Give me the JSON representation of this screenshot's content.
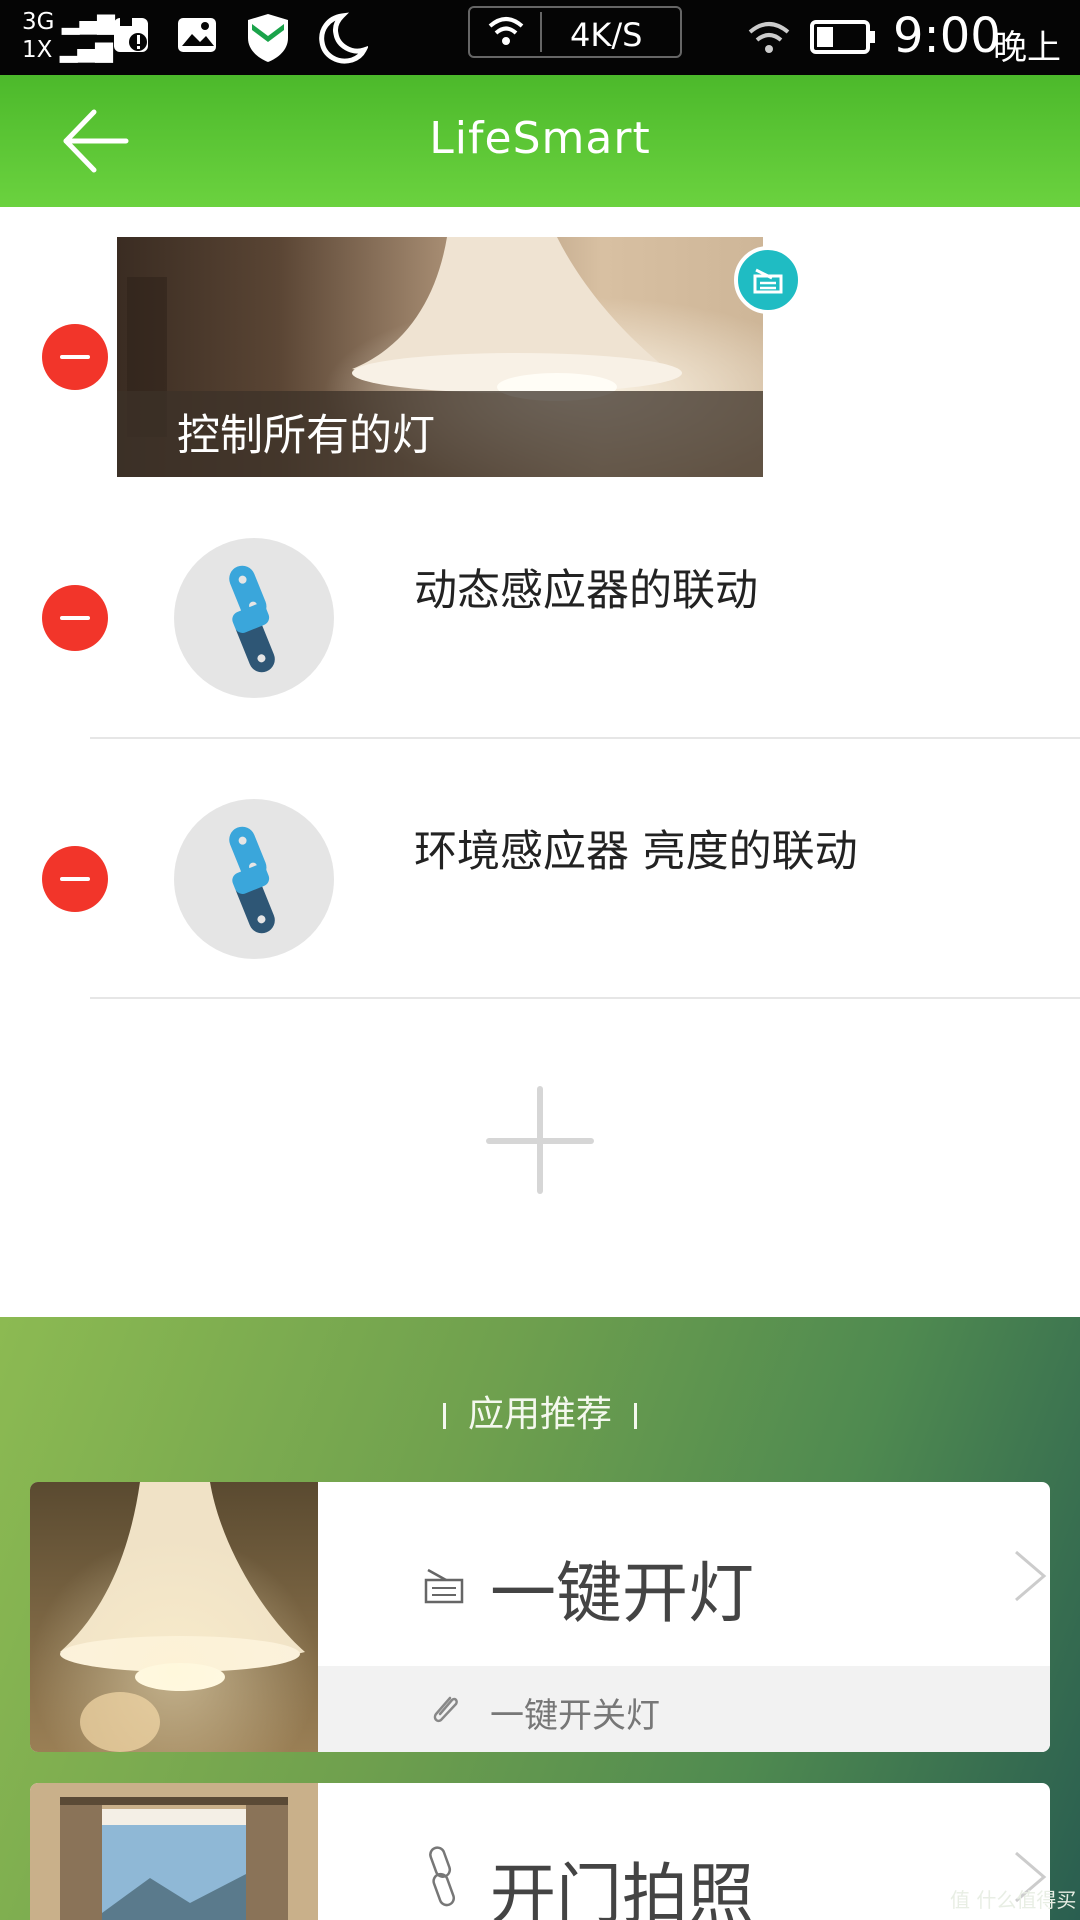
{
  "status_bar": {
    "net_top": "3G",
    "net_bottom": "1X",
    "speed": "4K/S",
    "time": "9:00",
    "period": "晚上",
    "icons": [
      "signal-icon",
      "sim-alert-icon",
      "image-icon",
      "shield-icon",
      "moon-icon",
      "wifi-icon",
      "battery-icon"
    ]
  },
  "app_bar": {
    "title": "LifeSmart",
    "back_icon": "back-arrow-icon"
  },
  "scenes": [
    {
      "type": "image-card",
      "label": "控制所有的灯",
      "badge_icon": "scene-badge-icon"
    },
    {
      "type": "linkage",
      "label": "动态感应器的联动",
      "icon": "chain-link-icon"
    },
    {
      "type": "linkage",
      "label": "环境感应器 亮度的联动",
      "icon": "chain-link-icon"
    }
  ],
  "add_button_icon": "plus-icon",
  "recommend": {
    "title": "应用推荐",
    "items": [
      {
        "name": "一键开灯",
        "subtitle": "一键开关灯",
        "icon": "scene-icon",
        "sub_icon": "paperclip-icon"
      },
      {
        "name": "开门拍照",
        "icon": "chain-link-icon"
      }
    ]
  },
  "watermark": "值 什么值得买",
  "colors": {
    "accent_green": "#5cc536",
    "delete_red": "#f2352a",
    "badge_teal": "#1fbcc3",
    "chain_blue": "#3aa6db",
    "chain_dark": "#2e5675"
  }
}
